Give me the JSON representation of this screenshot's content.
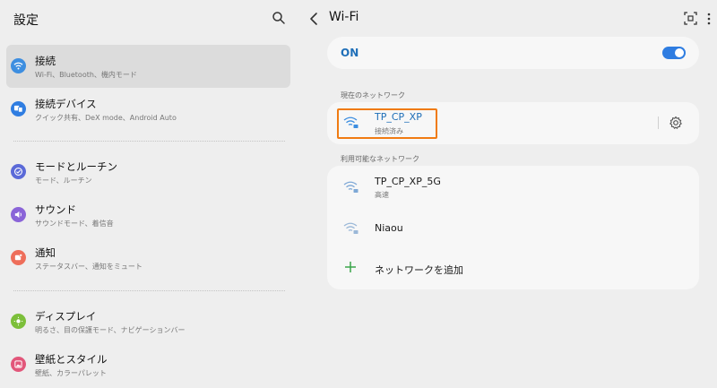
{
  "left": {
    "title": "設定",
    "items": [
      {
        "title": "接続",
        "sub": "Wi-Fi、Bluetooth、機内モード",
        "icon": "wifi-icon",
        "color": "#3d8ee0"
      },
      {
        "title": "接続デバイス",
        "sub": "クイック共有、DeX mode、Android Auto",
        "icon": "devices-icon",
        "color": "#2f7de1"
      },
      {
        "title": "モードとルーチン",
        "sub": "モード、ルーチン",
        "icon": "check-circle-icon",
        "color": "#5b6ad8"
      },
      {
        "title": "サウンド",
        "sub": "サウンドモード、着信音",
        "icon": "volume-icon",
        "color": "#8a64d8"
      },
      {
        "title": "通知",
        "sub": "ステータスバー、通知をミュート",
        "icon": "notification-icon",
        "color": "#ee6e5a"
      },
      {
        "title": "ディスプレイ",
        "sub": "明るさ、目の保護モード、ナビゲーションバー",
        "icon": "brightness-icon",
        "color": "#7cbf3a"
      },
      {
        "title": "壁紙とスタイル",
        "sub": "壁紙、カラーパレット",
        "icon": "wallpaper-icon",
        "color": "#e2567a"
      }
    ]
  },
  "right": {
    "title": "Wi-Fi",
    "toggle_label": "ON",
    "toggle_on": true,
    "current_section": "現在のネットワーク",
    "current": {
      "name": "TP_CP_XP",
      "status": "接続済み"
    },
    "available_section": "利用可能なネットワーク",
    "available": [
      {
        "name": "TP_CP_XP_5G",
        "sub": "高速"
      },
      {
        "name": "Niaou",
        "sub": ""
      }
    ],
    "add_network": "ネットワークを追加",
    "colors": {
      "accent": "#1f6fb8",
      "highlight": "#f07b12"
    }
  }
}
